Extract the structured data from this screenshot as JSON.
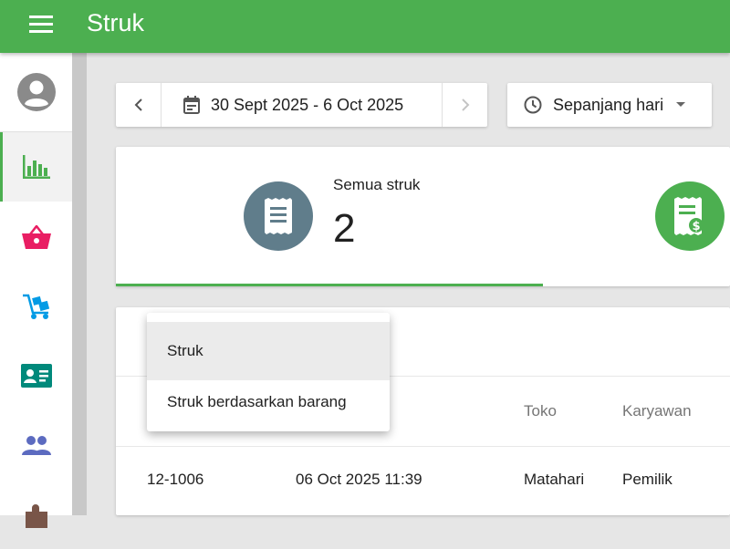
{
  "appbar": {
    "title": "Struk"
  },
  "sidebar": {
    "items": [
      {
        "icon": "bar-chart-icon",
        "color": "#4CAF50",
        "active": true
      },
      {
        "icon": "basket-icon",
        "color": "#E91E63"
      },
      {
        "icon": "cart-icon",
        "color": "#039BE5"
      },
      {
        "icon": "id-card-icon",
        "color": "#00897B"
      },
      {
        "icon": "people-icon",
        "color": "#5C6BC0"
      },
      {
        "icon": "puzzle-icon",
        "color": "#795548"
      }
    ]
  },
  "date_filter": {
    "range": "30 Sept 2025 - 6 Oct 2025"
  },
  "time_filter": {
    "label": "Sepanjang hari"
  },
  "summary": {
    "all_receipts_label": "Semua struk",
    "all_receipts_value": "2"
  },
  "dropdown": {
    "items": [
      "Struk",
      "Struk berdasarkan barang"
    ],
    "selected": "Struk"
  },
  "table": {
    "headers": [
      "Toko",
      "Karyawan"
    ],
    "rows": [
      {
        "receipt_no": "12-1006",
        "date": "06 Oct 2025 11:39",
        "store": "Matahari",
        "employee": "Pemilik"
      }
    ]
  },
  "colors": {
    "primary": "#4CAF50",
    "receipt_circle": "#607D8B"
  }
}
